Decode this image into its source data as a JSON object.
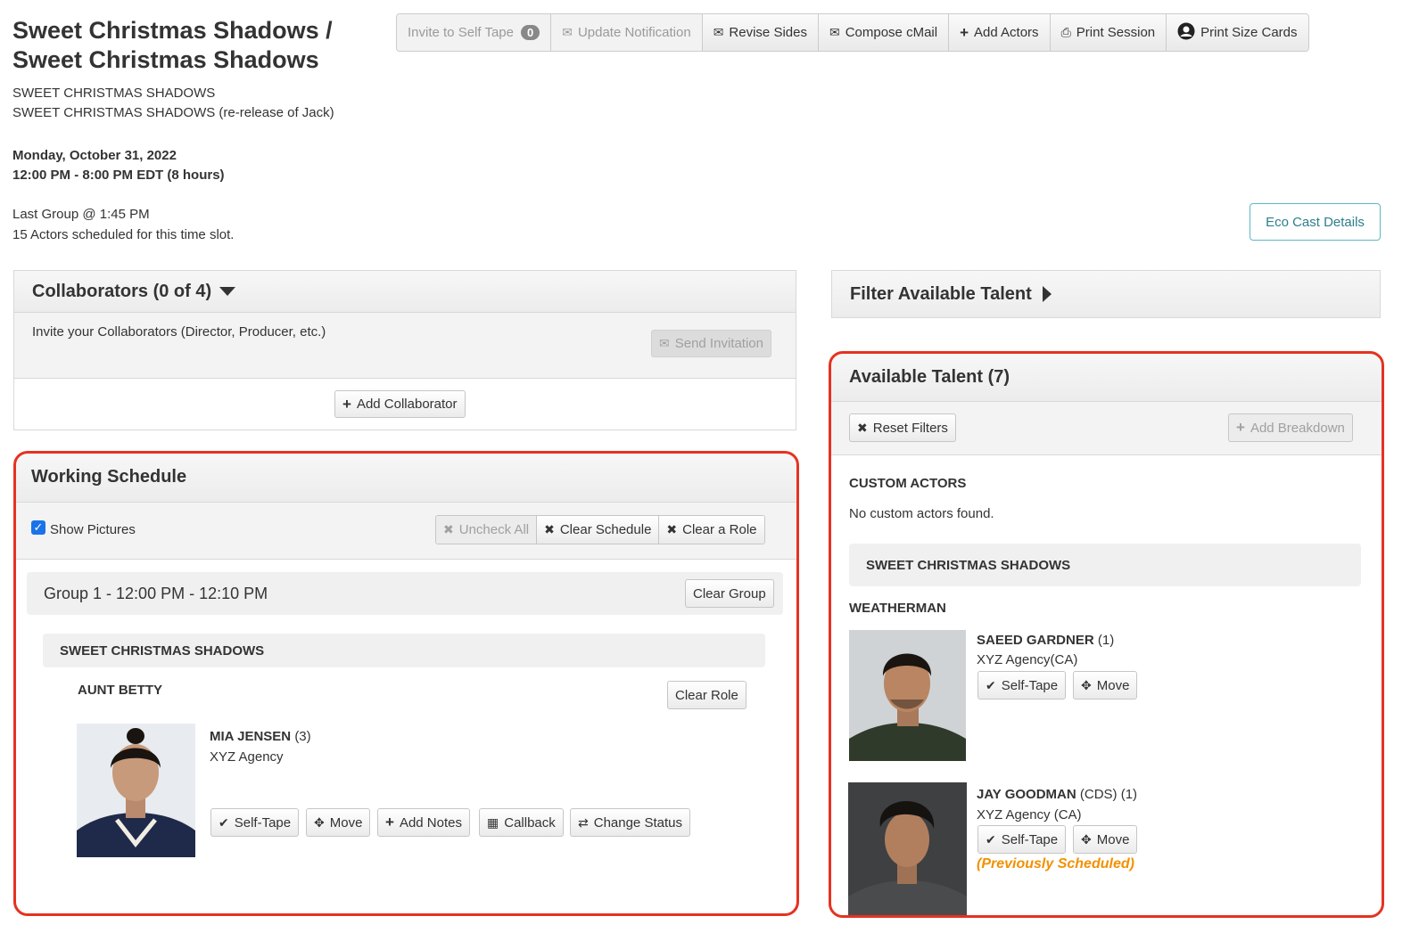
{
  "header": {
    "title": "Sweet Christmas Shadows / Sweet Christmas Shadows",
    "project_line1": "SWEET CHRISTMAS SHADOWS",
    "project_line2": "SWEET CHRISTMAS SHADOWS (re-release of Jack)",
    "date": "Monday, October 31, 2022",
    "time": "12:00 PM - 8:00 PM EDT (8 hours)",
    "last_group": "Last Group @ 1:45 PM",
    "actors_scheduled": "15 Actors scheduled for this time slot."
  },
  "toolbar": {
    "invite_self_tape": "Invite to Self Tape",
    "invite_count": "0",
    "update_notification": "Update Notification",
    "revise_sides": "Revise Sides",
    "compose_cmail": "Compose cMail",
    "add_actors": "Add Actors",
    "print_session": "Print Session",
    "print_size_cards": "Print Size Cards"
  },
  "eco_cast_details": "Eco Cast Details",
  "collaborators": {
    "title": "Collaborators (0 of 4)",
    "invite_text": "Invite your Collaborators (Director, Producer, etc.)",
    "send_invitation": "Send Invitation",
    "add_collaborator": "Add Collaborator"
  },
  "working_schedule": {
    "title": "Working Schedule",
    "show_pictures": "Show Pictures",
    "uncheck_all": "Uncheck All",
    "clear_schedule": "Clear Schedule",
    "clear_a_role": "Clear a Role",
    "group_label": "Group 1 - 12:00 PM - 12:10 PM",
    "clear_group": "Clear Group",
    "project": "SWEET CHRISTMAS SHADOWS",
    "role": "AUNT BETTY",
    "clear_role": "Clear Role",
    "actor": {
      "name": "MIA JENSEN",
      "count": "(3)",
      "agency": "XYZ Agency",
      "self_tape": "Self-Tape",
      "move": "Move",
      "add_notes": "Add Notes",
      "callback": "Callback",
      "change_status": "Change Status"
    }
  },
  "filter": {
    "title": "Filter Available Talent"
  },
  "available_talent": {
    "title": "Available Talent (7)",
    "reset_filters": "Reset Filters",
    "add_breakdown": "Add Breakdown",
    "custom_actors_heading": "CUSTOM ACTORS",
    "no_custom": "No custom actors found.",
    "project": "SWEET CHRISTMAS SHADOWS",
    "role": "WEATHERMAN",
    "actors": [
      {
        "name": "SAEED GARDNER",
        "count": "(1)",
        "agency": "XYZ Agency(CA)",
        "self_tape": "Self-Tape",
        "move": "Move"
      },
      {
        "name": "JAY GOODMAN",
        "count": "(CDS) (1)",
        "agency": "XYZ Agency (CA)",
        "self_tape": "Self-Tape",
        "move": "Move",
        "note": "(Previously Scheduled)"
      }
    ]
  },
  "colors": {
    "highlight": "#e53222",
    "previously_scheduled": "#f29100",
    "eco_border": "#5bb8c4",
    "checkbox": "#1a73e8"
  }
}
